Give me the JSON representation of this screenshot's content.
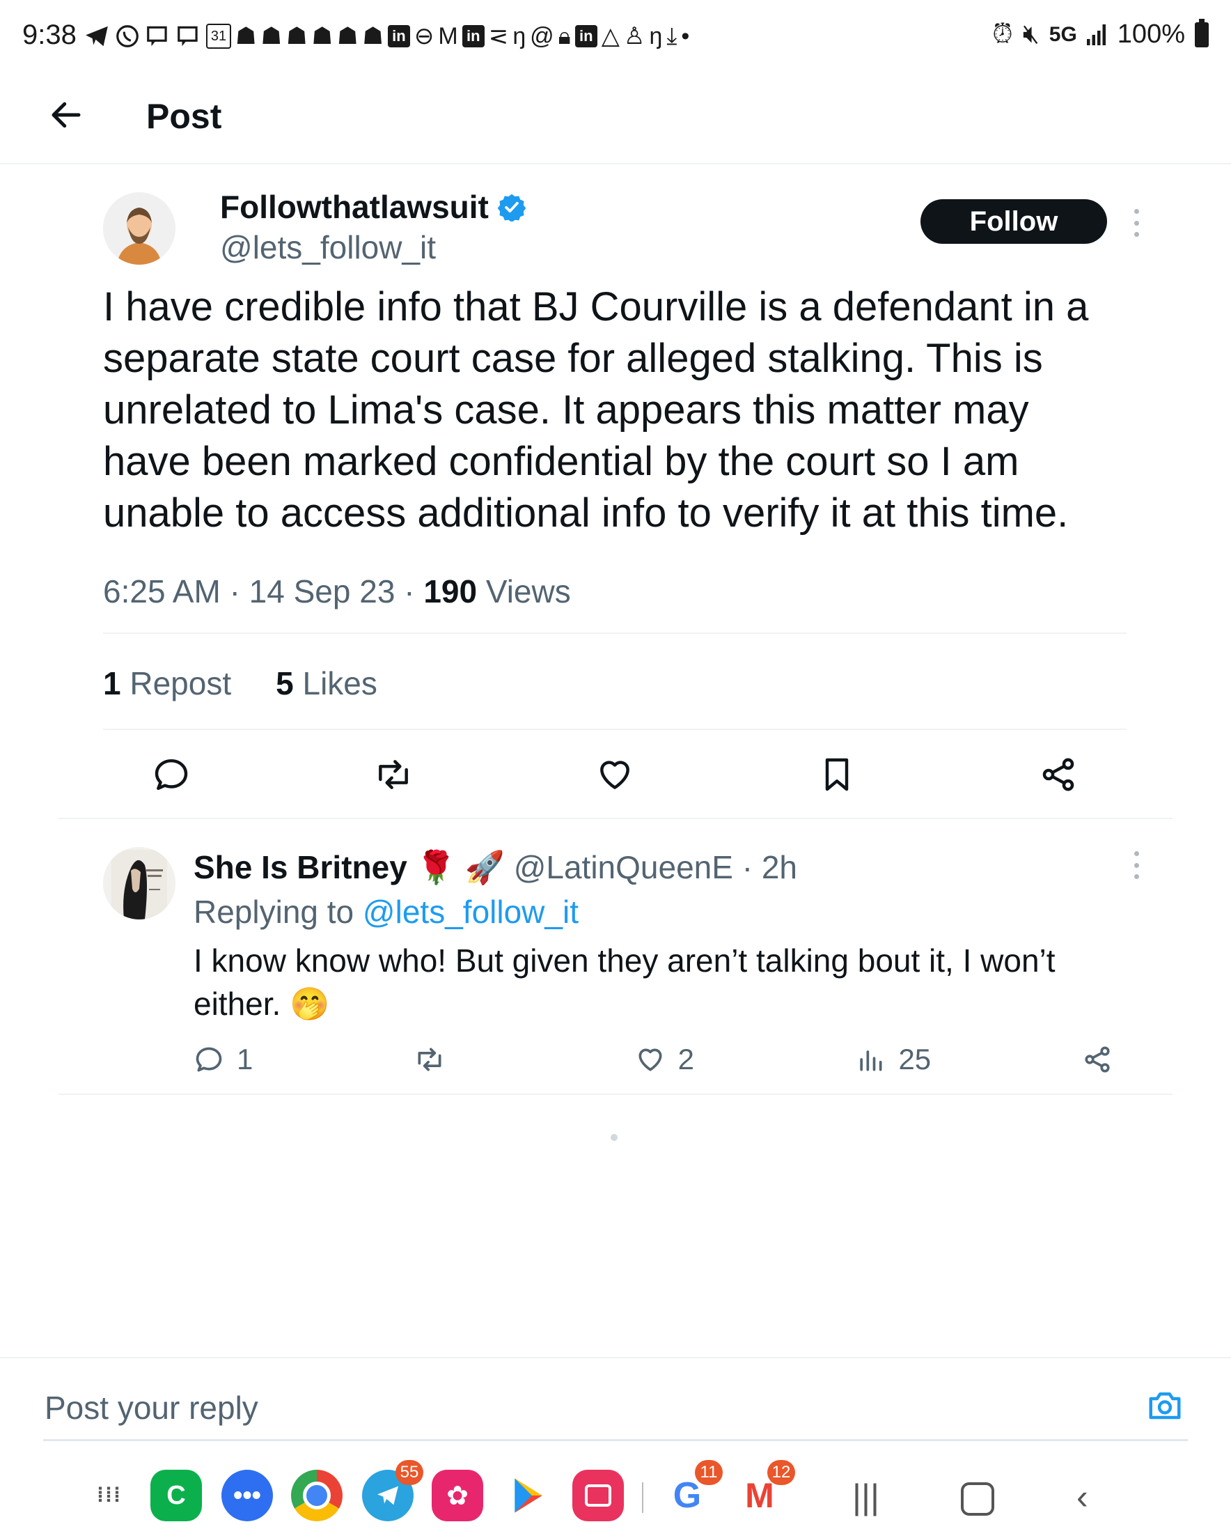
{
  "status_bar": {
    "time": "9:38",
    "network": "5G",
    "battery": "100%",
    "notification_icons": [
      "telegram-icon",
      "whatsapp-icon",
      "chat-icon",
      "chat-icon",
      "calendar-icon",
      "snapchat-icon",
      "snapchat-icon",
      "snapchat-icon",
      "snapchat-icon",
      "snapchat-icon",
      "snapchat-icon",
      "linkedin-icon",
      "app-icon",
      "gmail-icon",
      "linkedin-icon",
      "app-icon",
      "app-icon",
      "threads-icon",
      "lock-icon",
      "linkedin-icon",
      "drive-icon",
      "app-icon",
      "app-icon",
      "download-icon",
      "dot-icon"
    ],
    "calendar_day": "31"
  },
  "header": {
    "title": "Post"
  },
  "tweet": {
    "display_name": "Followthatlawsuit",
    "handle": "@lets_follow_it",
    "follow_label": "Follow",
    "text": "I have credible info that BJ Courville is a defendant in a separate state court case for alleged stalking. This is unrelated to Lima's case. It appears this matter may have been marked confidential by the court so I am unable to access additional info to verify it at this time.",
    "time": "6:25 AM",
    "sep": "·",
    "date": "14 Sep 23",
    "views_count": "190",
    "views_label": "Views",
    "reposts_count": "1",
    "reposts_label": "Repost",
    "likes_count": "5",
    "likes_label": "Likes"
  },
  "reply": {
    "display_name": "She Is Britney",
    "emojis": "🌹 🚀",
    "handle": "@LatinQueenE",
    "sep": "·",
    "age": "2h",
    "replying_prefix": "Replying to",
    "replying_handle": "@lets_follow_it",
    "text": "I know know who! But given they aren’t talking bout it, I won’t either.",
    "emoji_end": "🤭",
    "reply_count": "1",
    "like_count": "2",
    "view_count": "25"
  },
  "composer": {
    "placeholder": "Post your reply"
  },
  "dock": {
    "apps": [
      {
        "name": "app-drawer",
        "badge": ""
      },
      {
        "name": "phone-app",
        "letter": "C",
        "color": "#0bb04c",
        "badge": ""
      },
      {
        "name": "messages-app",
        "color": "#2e6ff2",
        "badge": ""
      },
      {
        "name": "chrome-app",
        "badge": ""
      },
      {
        "name": "telegram-app",
        "color": "#2aa3df",
        "badge": "55"
      },
      {
        "name": "gallery-app",
        "color": "#e8266e",
        "badge": ""
      },
      {
        "name": "play-store-app",
        "badge": ""
      },
      {
        "name": "camera-app",
        "color": "#e9325d",
        "badge": ""
      },
      {
        "name": "google-app",
        "badge": "11"
      },
      {
        "name": "gmail-app",
        "badge": "12"
      }
    ]
  }
}
